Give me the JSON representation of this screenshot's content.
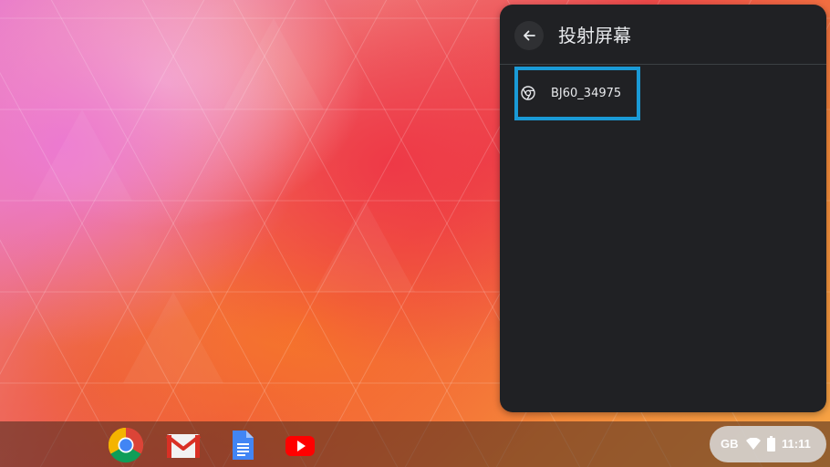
{
  "cast_panel": {
    "title": "投射屏幕",
    "devices": [
      {
        "label": "BJ60_34975",
        "icon": "cast-device-icon"
      }
    ]
  },
  "shelf": {
    "apps": [
      {
        "name": "chrome",
        "icon": "chrome-icon"
      },
      {
        "name": "gmail",
        "icon": "gmail-icon"
      },
      {
        "name": "docs",
        "icon": "docs-icon"
      },
      {
        "name": "youtube",
        "icon": "youtube-icon"
      }
    ],
    "status": {
      "keyboard_layout": "GB",
      "time": "11:11"
    }
  },
  "colors": {
    "panel_bg": "#202124",
    "highlight": "#1a9ad6"
  }
}
